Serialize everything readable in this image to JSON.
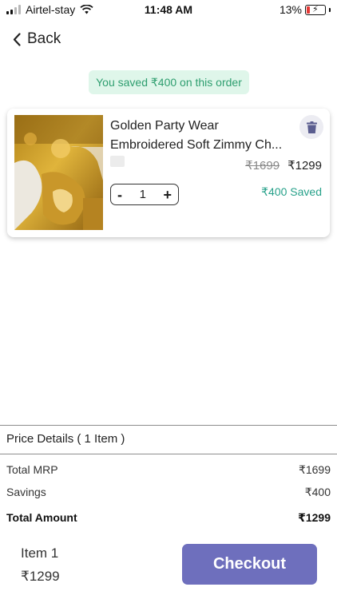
{
  "status_bar": {
    "carrier": "Airtel-stay",
    "time": "11:48 AM",
    "battery": "13%"
  },
  "nav": {
    "back_label": "Back"
  },
  "banner": {
    "text": "You saved ₹400 on this order"
  },
  "cart_item": {
    "title_line1": "Golden Party Wear",
    "title_line2": "Embroidered Soft Zimmy Ch...",
    "mrp": "₹1699",
    "price": "₹1299",
    "quantity": "1",
    "saved_text": "₹400 Saved",
    "decrement_label": "-",
    "increment_label": "+"
  },
  "price_details": {
    "heading": "Price Details ( 1 Item )",
    "total_mrp_label": "Total MRP",
    "total_mrp_value": "₹1699",
    "savings_label": "Savings",
    "savings_value": "₹400",
    "total_label": "Total Amount",
    "total_value": "₹1299"
  },
  "footer": {
    "item_label": "Item 1",
    "price": "₹1299",
    "checkout_label": "Checkout"
  },
  "colors": {
    "accent": "#6e6fbd",
    "savings_green": "#27a18a",
    "banner_bg": "#dff6ea"
  },
  "icons": [
    "signal-icon",
    "wifi-icon",
    "battery-icon",
    "chevron-left-icon",
    "trash-icon"
  ]
}
